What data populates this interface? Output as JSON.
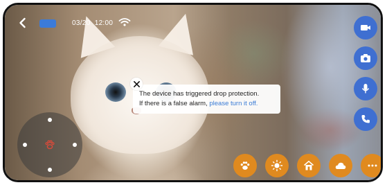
{
  "status": {
    "date": "03/20",
    "time": "12:00",
    "rec_color": "#3b7bd9"
  },
  "toast": {
    "line1": "The device has triggered drop protection.",
    "line2_prefix": "If there is a false alarm, ",
    "link_text": "please turn it off."
  },
  "icons": {
    "back": "chevron-left-icon",
    "wifi": "wifi-icon",
    "close": "close-icon",
    "joystick_center": "paw-icon",
    "rail": [
      "video-record-icon",
      "camera-icon",
      "microphone-icon",
      "phone-call-icon"
    ],
    "actions": [
      "paw-icon",
      "light-icon",
      "home-icon",
      "cloud-icon",
      "more-icon"
    ]
  },
  "colors": {
    "rail_bg": "#3f6fd1",
    "action_bg": "#e08a1f",
    "joystick_accent": "#d84a3a",
    "link": "#3a7bd5"
  }
}
